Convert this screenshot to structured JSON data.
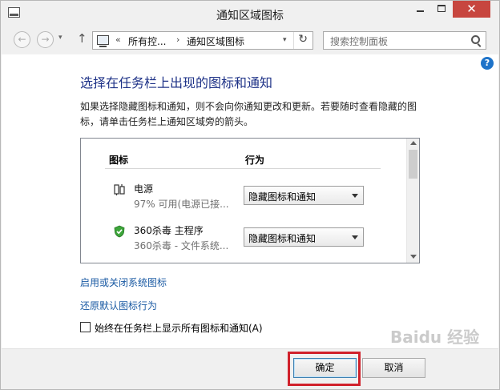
{
  "window": {
    "title": "通知区域图标",
    "close_glyph": "✕"
  },
  "nav": {
    "back_glyph": "←",
    "forward_glyph": "→",
    "dropdown_glyph": "▾",
    "up_glyph": "↑",
    "address_sep": "«",
    "breadcrumb_1": "所有控...",
    "breadcrumb_sep": "›",
    "breadcrumb_2": "通知区域图标",
    "refresh_glyph": "↻",
    "search_placeholder": "搜索控制面板"
  },
  "content": {
    "help_glyph": "?",
    "heading": "选择在任务栏上出现的图标和通知",
    "description": "如果选择隐藏图标和通知，则不会向你通知更改和更新。若要随时查看隐藏的图标，请单击任务栏上通知区域旁的箭头。",
    "columns": {
      "icon": "图标",
      "behavior": "行为"
    },
    "rows": [
      {
        "name": "电源",
        "subtitle": "97% 可用(电源已接...",
        "behavior": "隐藏图标和通知",
        "icon": "power-plug-icon"
      },
      {
        "name": "360杀毒 主程序",
        "subtitle": "360杀毒 - 文件系统...",
        "behavior": "隐藏图标和通知",
        "icon": "shield-icon"
      }
    ],
    "link_system_icons": "启用或关闭系统图标",
    "link_restore": "还原默认图标行为",
    "checkbox_label": "始终在任务栏上显示所有图标和通知(A)",
    "checkbox_checked": false
  },
  "footer": {
    "ok_label": "确定",
    "cancel_label": "取消",
    "highlight_color": "#d0212b"
  },
  "watermark": "Baidu 经验"
}
